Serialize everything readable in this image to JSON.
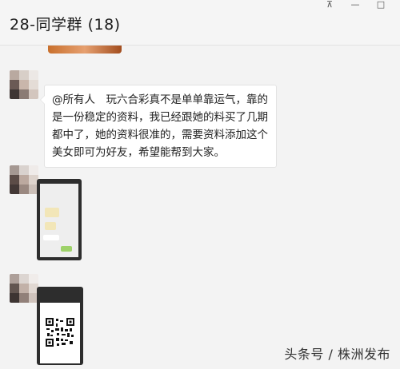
{
  "window": {
    "title": "28-同学群 (18)",
    "controls": {
      "pin": "⊼",
      "minimize": "—",
      "maximize": "□"
    }
  },
  "messages": [
    {
      "type": "image",
      "sender_avatar": "blurred-avatar-1"
    },
    {
      "type": "text",
      "sender_avatar": "blurred-avatar-2",
      "text": "@所有人　玩六合彩真不是单单靠运气，靠的是一份稳定的资料，我已经跟她的料买了几期都中了，她的资料很准的，需要资料添加这个美女即可为好友，希望能帮到大家。"
    },
    {
      "type": "image",
      "sender_avatar": "blurred-avatar-3",
      "content": "chat-screenshot"
    },
    {
      "type": "image",
      "sender_avatar": "blurred-avatar-4",
      "content": "qr-code-card"
    }
  ],
  "watermark": "头条号 / 株洲发布",
  "colors": {
    "background": "#f3f3f3",
    "bubble": "#ffffff",
    "titlebar": "#f5f5f5"
  }
}
